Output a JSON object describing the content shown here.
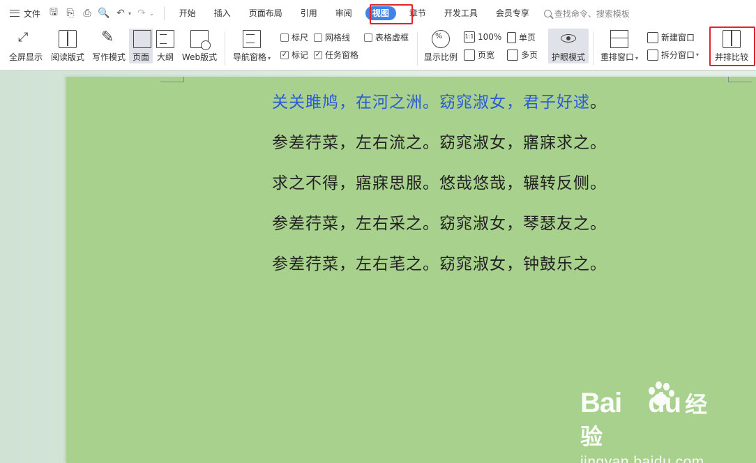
{
  "tabbar": {
    "file_label": "文件",
    "tabs": [
      "开始",
      "插入",
      "页面布局",
      "引用",
      "审阅",
      "视图",
      "章节",
      "开发工具",
      "会员专享"
    ],
    "active_tab": "视图",
    "search_placeholder": "查找命令、搜索模板"
  },
  "ribbon": {
    "fullscreen": "全屏显示",
    "reading": "阅读版式",
    "writing": "写作模式",
    "page": "页面",
    "outline": "大纲",
    "web": "Web版式",
    "nav_pane": "导航窗格",
    "ruler": "标尺",
    "gridlines": "网格线",
    "table_gridlines": "表格虚框",
    "marks": "标记",
    "task_pane": "任务窗格",
    "zoom": "显示比例",
    "zoom_100": "100%",
    "page_width": "页宽",
    "single_page": "单页",
    "multi_page": "多页",
    "eye_mode": "护眼模式",
    "arrange": "重排窗口",
    "new_window": "新建窗口",
    "split_window": "拆分窗口",
    "side_by_side": "并排比较"
  },
  "checkbox_states": {
    "ruler": false,
    "gridlines": false,
    "table_gridlines": false,
    "marks": true,
    "task_pane": true
  },
  "document": {
    "line1_highlight": "关关雎鸠，在河之洲。窈窕淑女，君子好逑",
    "line1_end": "。",
    "lines": [
      "参差荇菜，左右流之。窈窕淑女，寤寐求之。",
      "求之不得，寤寐思服。悠哉悠哉，辗转反侧。",
      "参差荇菜，左右采之。窈窕淑女，琴瑟友之。",
      "参差荇菜，左右芼之。窈窕淑女，钟鼓乐之。"
    ]
  },
  "watermark": {
    "brand": "Bai",
    "brand2": "du",
    "brand_cn": "经验",
    "url": "jingyan.baidu.com"
  },
  "colors": {
    "accent": "#3d84e6",
    "page_bg": "#a8d18d",
    "highlight_text": "#2b5bd6",
    "annotation_red": "#e0242a"
  }
}
